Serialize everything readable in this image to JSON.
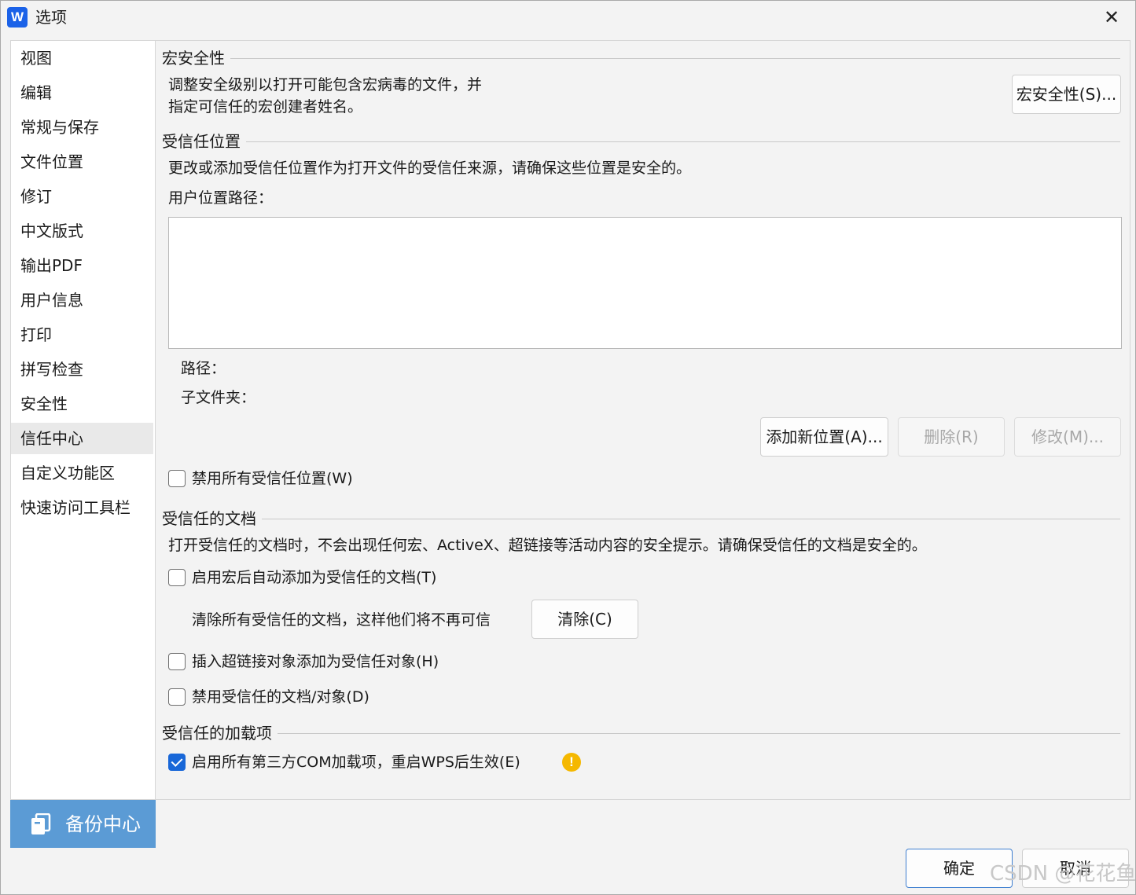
{
  "window": {
    "app_icon_letter": "W",
    "title": "选项",
    "close_glyph": "✕"
  },
  "sidebar": {
    "items": [
      {
        "label": "视图"
      },
      {
        "label": "编辑"
      },
      {
        "label": "常规与保存"
      },
      {
        "label": "文件位置"
      },
      {
        "label": "修订"
      },
      {
        "label": "中文版式"
      },
      {
        "label": "输出PDF"
      },
      {
        "label": "用户信息"
      },
      {
        "label": "打印"
      },
      {
        "label": "拼写检查"
      },
      {
        "label": "安全性"
      },
      {
        "label": "信任中心",
        "active": true
      },
      {
        "label": "自定义功能区"
      },
      {
        "label": "快速访问工具栏"
      }
    ],
    "backup_label": "备份中心"
  },
  "macro_security": {
    "heading": "宏安全性",
    "description_line1": "调整安全级别以打开可能包含宏病毒的文件，并",
    "description_line2": "指定可信任的宏创建者姓名。",
    "button_label": "宏安全性(S)..."
  },
  "trusted_locations": {
    "heading": "受信任位置",
    "description": "更改或添加受信任位置作为打开文件的受信任来源，请确保这些位置是安全的。",
    "user_path_label": "用户位置路径：",
    "path_label": "路径：",
    "subfolder_label": "子文件夹：",
    "add_button": "添加新位置(A)...",
    "delete_button": "删除(R)",
    "modify_button": "修改(M)...",
    "disable_all_label": "禁用所有受信任位置(W)",
    "disable_all_checked": false
  },
  "trusted_documents": {
    "heading": "受信任的文档",
    "description": "打开受信任的文档时，不会出现任何宏、ActiveX、超链接等活动内容的安全提示。请确保受信任的文档是安全的。",
    "auto_add_label": "启用宏后自动添加为受信任的文档(T)",
    "auto_add_checked": false,
    "clear_text": "清除所有受信任的文档，这样他们将不再可信",
    "clear_button": "清除(C)",
    "hyperlink_label": "插入超链接对象添加为受信任对象(H)",
    "hyperlink_checked": false,
    "disable_label": "禁用受信任的文档/对象(D)",
    "disable_checked": false
  },
  "trusted_addins": {
    "heading": "受信任的加载项",
    "com_label": "启用所有第三方COM加载项，重启WPS后生效(E)",
    "com_checked": true,
    "warning_glyph": "!"
  },
  "footer": {
    "ok_button": "确定",
    "cancel_button": "取消",
    "watermark": "CSDN @花花鱼"
  },
  "colors": {
    "accent": "#1867d8",
    "backup_bg": "#5b9bd5",
    "warning": "#f5b800"
  }
}
